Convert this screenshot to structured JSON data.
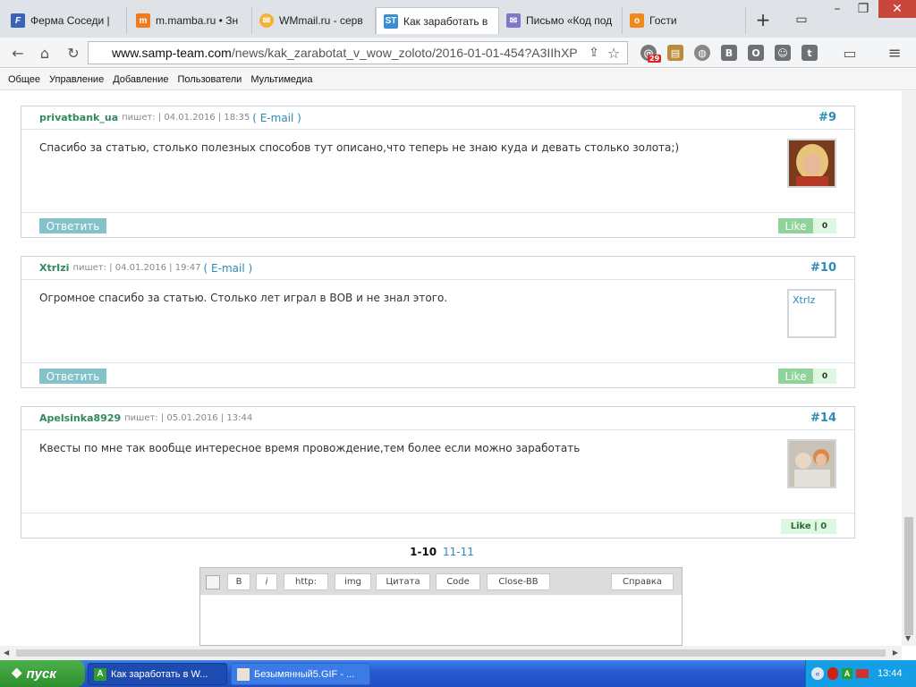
{
  "tabs": [
    {
      "label": "Ферма Соседи |",
      "icon": "fs-icon"
    },
    {
      "label": "m.mamba.ru • Зн",
      "icon": "mamba-icon"
    },
    {
      "label": "WMmail.ru - серв",
      "icon": "wmmail-icon"
    },
    {
      "label": "Как заработать в W",
      "icon": "st-icon"
    },
    {
      "label": "Письмо «Код под",
      "icon": "mail-icon"
    },
    {
      "label": "Гости",
      "icon": "ok-icon"
    }
  ],
  "address": {
    "host": "www.samp-team.com",
    "path": "/news/kak_zarabotat_v_wow_zoloto/2016-01-01-454?A3IIhXP"
  },
  "extensions": {
    "mail_badge": "29"
  },
  "site_menu": [
    "Общее",
    "Управление",
    "Добавление",
    "Пользователи",
    "Мультимедиа"
  ],
  "comments": [
    {
      "author": "privatbank_ua",
      "wrote": "пишет:",
      "date": "| 04.01.2016 | 18:35",
      "email": "( E-mail )",
      "num": "#9",
      "text": "Спасибо за статью, столько полезных способов тут описано,что теперь не знаю куда и девать столько золота;)",
      "reply": "Ответить",
      "like": "Like",
      "like_count": "0"
    },
    {
      "author": "XtrIzi",
      "wrote": "пишет:",
      "date": "| 04.01.2016 | 19:47",
      "email": "( E-mail )",
      "num": "#10",
      "text": "Огромное спасибо за статью. Столько лет играл в ВОВ и не знал этого.",
      "avatar_alt": "XtrIz",
      "reply": "Ответить",
      "like": "Like",
      "like_count": "0"
    },
    {
      "author": "Apelsinka8929",
      "wrote": "пишет:",
      "date": "| 05.01.2016 | 13:44",
      "num": "#14",
      "text": "Квесты по мне так вообще интересное время провождение,тем более если можно заработать",
      "like_combined": "Like | 0"
    }
  ],
  "pager": {
    "current": "1-10",
    "next": "11-11"
  },
  "editor_buttons": [
    "B",
    "i",
    "http:",
    "img",
    "Цитата",
    "Code",
    "Close-BB",
    "Справка"
  ],
  "taskbar": {
    "start": "пуск",
    "tasks": [
      "Как заработать в W...",
      "Безымянный5.GIF - ..."
    ],
    "clock": "13:44"
  }
}
